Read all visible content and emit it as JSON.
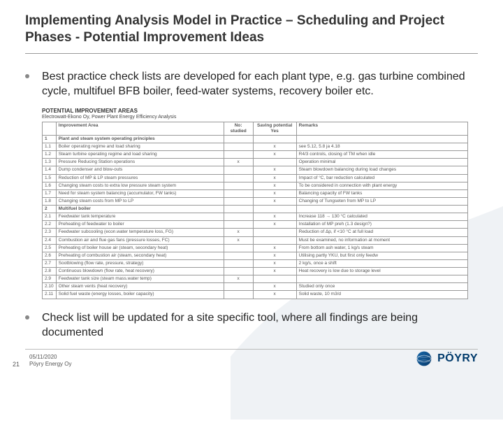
{
  "title": "Implementing Analysis Model in Practice – Scheduling and Project Phases - Potential Improvement Ideas",
  "bullets": {
    "b1": "Best practice check lists are developed for each plant type, e.g. gas turbine combined cycle, multifuel BFB boiler, feed-water systems, recovery boiler etc.",
    "b2": "Check list will be updated for a site specific tool, where all findings are being documented"
  },
  "table": {
    "caption1": "POTENTIAL IMPROVEMENT AREAS",
    "caption2": "Electrowatt-Ekono Oy, Power Plant Energy Efficiency Analysis",
    "headers": {
      "h1": "",
      "h2": "Improvement Area",
      "h3": "No: studied",
      "h4": "Saving potential Yes",
      "h5": "Remarks"
    },
    "rows": [
      {
        "n": "1",
        "area": "Plant and steam system operating principles",
        "stud": "",
        "sav": "",
        "rem": "",
        "section": true
      },
      {
        "n": "1.1",
        "area": "Boiler operating regime and load sharing",
        "stud": "",
        "sav": "x",
        "rem": "see 5.12, 5.8 ja 4.18"
      },
      {
        "n": "1.2",
        "area": "Steam turbine operating regime and load sharing",
        "stud": "",
        "sav": "x",
        "rem": "R4/3 controls, closing of TM when idle"
      },
      {
        "n": "1.3",
        "area": "Pressure Reducing Station operations",
        "stud": "x",
        "sav": "",
        "rem": "Operation minimal"
      },
      {
        "n": "1.4",
        "area": "Dump condenser and blow-outs",
        "stud": "",
        "sav": "x",
        "rem": "Steam blowdown balancing during load changes"
      },
      {
        "n": "1.5",
        "area": "Reduction of MP & LP steam pressures",
        "stud": "",
        "sav": "x",
        "rem": "Impact of °C, bar reduction calculated"
      },
      {
        "n": "1.6",
        "area": "Changing steam costs to extra low pressure steam system",
        "stud": "",
        "sav": "x",
        "rem": "To be considered in connection with plant energy"
      },
      {
        "n": "1.7",
        "area": "Need for steam system balancing (accumulator, FW tanks)",
        "stud": "",
        "sav": "x",
        "rem": "Balancing capacity of FW tanks"
      },
      {
        "n": "1.8",
        "area": "Changing steam costs from MP to LP",
        "stud": "",
        "sav": "x",
        "rem": "Changing of Tungseten from MP to LP"
      },
      {
        "n": "2",
        "area": "Multifuel boiler",
        "stud": "",
        "sav": "",
        "rem": "",
        "section": true
      },
      {
        "n": "2.1",
        "area": "Feedwater tank temperature",
        "stud": "",
        "sav": "x",
        "rem": "Increase 118 → 130 °C calculated"
      },
      {
        "n": "2.2",
        "area": "Preheating of feedwater to boiler",
        "stud": "",
        "sav": "x",
        "rem": "Installation of MP preh (1.3 design?)"
      },
      {
        "n": "2.3",
        "area": "Feedwater subcooling (econ.water temperature loss, FG)",
        "stud": "x",
        "sav": "",
        "rem": "Reduction of Δp, if <10 °C at full load"
      },
      {
        "n": "2.4",
        "area": "Combustion air and flue gas fans (pressure losses, FC)",
        "stud": "x",
        "sav": "",
        "rem": "Must be examined, no information at moment"
      },
      {
        "n": "2.5",
        "area": "Preheating of boiler house air (steam, secondary heat)",
        "stud": "",
        "sav": "x",
        "rem": "From bottom ash water, 1 kg/s steam"
      },
      {
        "n": "2.6",
        "area": "Preheating of combustion air (steam, secondary heat)",
        "stud": "",
        "sav": "x",
        "rem": "Utilising partly YKU, but first only feedw"
      },
      {
        "n": "2.7",
        "area": "Sootblowing (flow rate, pressure, strategy)",
        "stud": "",
        "sav": "x",
        "rem": "2 kg/s, once a shift"
      },
      {
        "n": "2.8",
        "area": "Continuous blowdown (flow rate, heat recovery)",
        "stud": "",
        "sav": "x",
        "rem": "Heat recovery is low due to storage level"
      },
      {
        "n": "2.9",
        "area": "Feedwater tank size (steam mass.water temp)",
        "stud": "x",
        "sav": "",
        "rem": ""
      },
      {
        "n": "2.10",
        "area": "Other steam vents (heat recovery)",
        "stud": "",
        "sav": "x",
        "rem": "Studied only once"
      },
      {
        "n": "2.11",
        "area": "Solid fuel waste (energy losses, boiler capacity)",
        "stud": "",
        "sav": "x",
        "rem": "Solid waste, 10 m3/d"
      }
    ]
  },
  "footer": {
    "page": "21",
    "date": "05/11/2020",
    "org": "Pöyry Energy Oy",
    "logo_text": "PÖYRY"
  }
}
